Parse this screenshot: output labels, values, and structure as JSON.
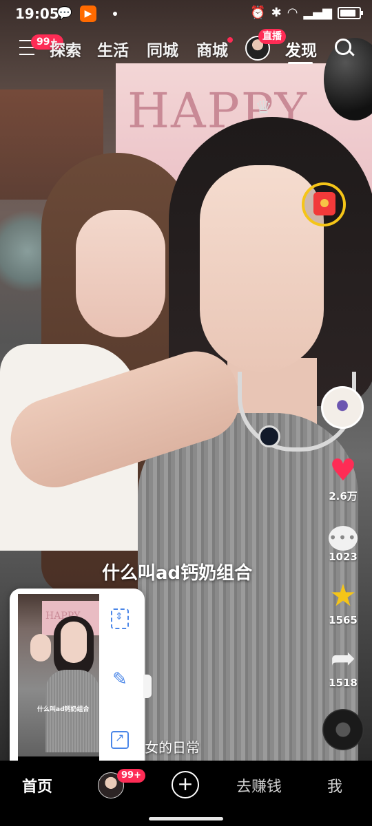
{
  "status_bar": {
    "time": "19:05",
    "battery_level": 0.85
  },
  "top_nav": {
    "menu_badge": "99+",
    "tabs": [
      "探索",
      "生活",
      "同城",
      "商城",
      "发现"
    ],
    "active_tab": "发现",
    "live_badge": "直播"
  },
  "background": {
    "board_text": "HAPPY"
  },
  "video": {
    "caption": "什么叫ad钙奶组合",
    "description_fragment": "女的日常"
  },
  "actions": {
    "likes": "2.6万",
    "comments": "1023",
    "favorites": "1565",
    "shares": "1518"
  },
  "screenshot_popup": {
    "thumb_caption": "什么叫ad钙奶组合",
    "thumb_board": "HAPPY"
  },
  "bottom_nav": {
    "home": "首页",
    "friends_badge": "99+",
    "earn": "去赚钱",
    "me": "我"
  },
  "colors": {
    "accent": "#fe2c55",
    "star": "#f5c518",
    "tool_blue": "#4a86e8"
  }
}
